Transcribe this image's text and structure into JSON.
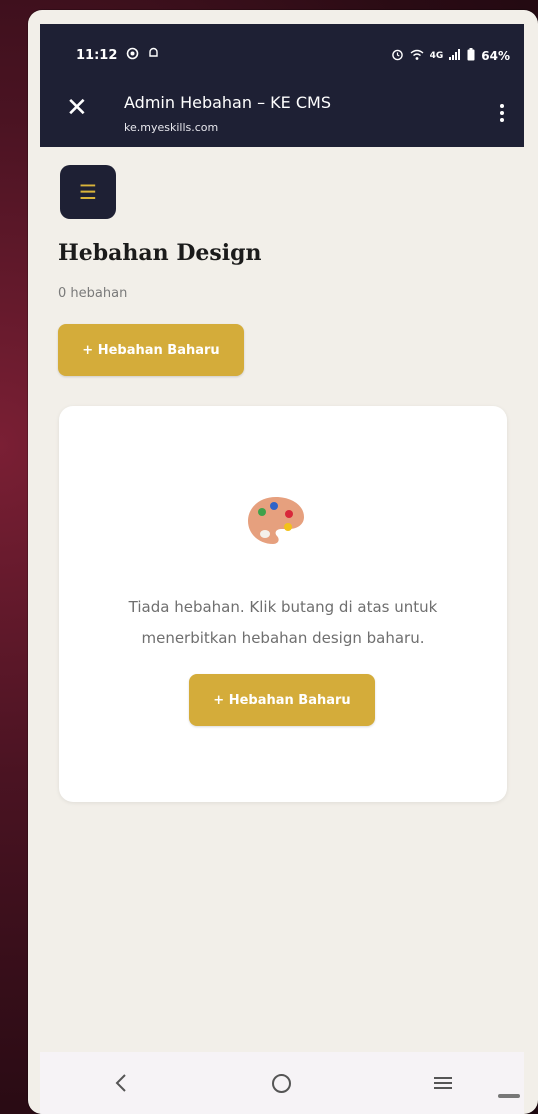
{
  "status_bar": {
    "time": "11:12",
    "left_icons": [
      "whatsapp-icon",
      "notification-icon"
    ],
    "network": "4G",
    "battery": "64%"
  },
  "app_bar": {
    "title": "Admin Hebahan – KE CMS",
    "url": "ke.myeskills.com"
  },
  "page": {
    "menu_icon": "☰",
    "title": "Hebahan Design",
    "count_text": "0 hebahan",
    "new_button_label": "+ Hebahan Baharu"
  },
  "empty_state": {
    "icon": "palette-icon",
    "line1": "Tiada hebahan. Klik butang di atas untuk",
    "line2": "menerbitkan hebahan design baharu.",
    "button_label": "+ Hebahan Baharu"
  },
  "nav_bar": {
    "back": "<",
    "home": "home",
    "recents": "recents"
  },
  "colors": {
    "dark": "#1e2034",
    "gold": "#d4ac3a",
    "background": "#f2efe9"
  }
}
